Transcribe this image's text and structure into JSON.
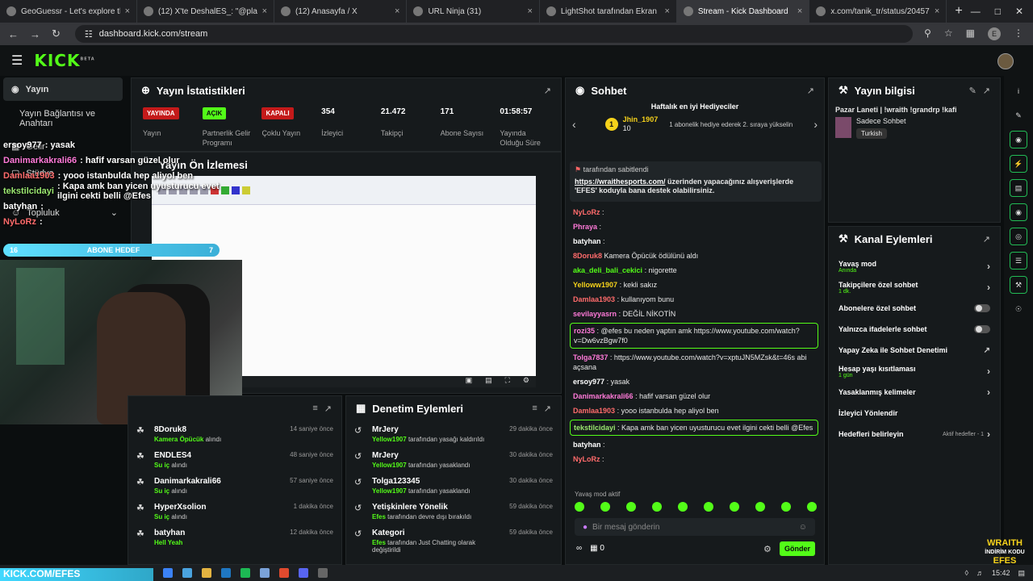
{
  "browser": {
    "tabs": [
      {
        "title": "GeoGuessr - Let's explore the w",
        "active": false
      },
      {
        "title": "(12) X'te DeshalES_: \"@platcom",
        "active": false
      },
      {
        "title": "(12) Anasayfa / X",
        "active": false
      },
      {
        "title": "URL Ninja (31)",
        "active": false
      },
      {
        "title": "LightShot tarafından Ekran Gör",
        "active": false
      },
      {
        "title": "Stream - Kick Dashboard",
        "active": true
      },
      {
        "title": "x.com/tanik_tr/status/2045768",
        "active": false
      }
    ],
    "url": "dashboard.kick.com/stream",
    "profile_letter": "E"
  },
  "kick": {
    "logo": "KICK",
    "logo_sup": "BETA"
  },
  "leftnav": {
    "items": [
      {
        "label": "Yayın",
        "active": true
      },
      {
        "label": "Yayın Bağlantısı ve Anahtarı"
      },
      {
        "label": "Gelir"
      },
      {
        "label": "Stüdyo"
      },
      {
        "label": "Topluluk"
      }
    ]
  },
  "stats_panel": {
    "title": "Yayın İstatistikleri",
    "items": [
      {
        "value": "YAYINDA",
        "label": "Yayın",
        "type": "red"
      },
      {
        "value": "AÇIK",
        "label": "Partnerlik Gelir Programı",
        "type": "green"
      },
      {
        "value": "KAPALI",
        "label": "Çoklu Yayın",
        "type": "red"
      },
      {
        "value": "354",
        "label": "İzleyici",
        "type": "text"
      },
      {
        "value": "21.472",
        "label": "Takipçi",
        "type": "text"
      },
      {
        "value": "171",
        "label": "Abone Sayısı",
        "type": "text"
      },
      {
        "value": "01:58:57",
        "label": "Yayında Olduğu Süre",
        "type": "text"
      }
    ]
  },
  "preview_title": "Yayın Ön İzlemesi",
  "overlay_chat": [
    {
      "user": "ersoy977",
      "text": ": yasak",
      "color": "#ffffff"
    },
    {
      "user": "Danimarkakrali66",
      "text": ": hafif varsan güzel olur",
      "color": "#ff7ad9"
    },
    {
      "user": "Damlaa1903",
      "text": ": yooo istanbulda hep aliyol ben",
      "color": "#ff6b6b"
    },
    {
      "user": "tekstilcidayi",
      "text": ": Kapa amk ban yicen uyusturucu evet ilgini cekti belli @Efes",
      "color": "#9be870"
    },
    {
      "user": "batyhan",
      "text": ":",
      "color": "#ffffff"
    },
    {
      "user": "NyLoRz",
      "text": ":",
      "color": "#ff6b6b"
    }
  ],
  "goal": {
    "left": "16",
    "label": "ABONE HEDEF",
    "right": "7"
  },
  "follows": [
    {
      "name": "8Doruk8",
      "by": "Kamera Öpücük",
      "action": "alındı",
      "time": "14 saniye önce"
    },
    {
      "name": "ENDLES4",
      "by": "Su iç",
      "action": "alındı",
      "time": "48 saniye önce"
    },
    {
      "name": "Danimarkakrali66",
      "by": "Su iç",
      "action": "alındı",
      "time": "57 saniye önce"
    },
    {
      "name": "HyperXsolion",
      "by": "Su iç",
      "action": "alındı",
      "time": "1 dakika önce"
    },
    {
      "name": "batyhan",
      "by": "Hell Yeah",
      "action": "",
      "time": "12 dakika önce"
    }
  ],
  "modactions": {
    "title": "Denetim Eylemleri",
    "items": [
      {
        "name": "MrJery",
        "by": "Yellow1907",
        "action": "tarafından yasağı kaldırıldı",
        "time": "29 dakika önce"
      },
      {
        "name": "MrJery",
        "by": "Yellow1907",
        "action": "tarafından yasaklandı",
        "time": "30 dakika önce"
      },
      {
        "name": "Tolga123345",
        "by": "Yellow1907",
        "action": "tarafından yasaklandı",
        "time": "30 dakika önce"
      },
      {
        "name": "Yetişkinlere Yönelik",
        "by": "Efes",
        "action": "tarafından devre dışı bırakıldı",
        "time": "59 dakika önce"
      },
      {
        "name": "Kategori",
        "by": "Efes",
        "action": "tarafından Just Chatting olarak değiştirildi",
        "time": "59 dakika önce"
      }
    ]
  },
  "chat": {
    "title": "Sohbet",
    "gifters_title": "Haftalık en iyi Hediyeciler",
    "top_gifter": "Jhin_1907",
    "top_gifter_count": "10",
    "gift_hint": "1 abonelik hediye ederek 2. sıraya yükselin",
    "pinned_by": "tarafından sabitlendi",
    "pinned_link": "https://wraithesports.com/",
    "pinned_text": "üzerinden yapacağınız alışverişlerde 'EFES' koduyla bana destek olabilirsiniz.",
    "messages": [
      {
        "user": "NyLoRz",
        "text": ":",
        "color": "#ff6b6b"
      },
      {
        "user": "Phraya",
        "text": ":",
        "color": "#ff7ad9"
      },
      {
        "user": "batyhan",
        "text": ":",
        "color": "#ffffff"
      },
      {
        "user": "8Doruk8",
        "text": "Kamera Öpücük ödülünü aldı",
        "color": "#ff6b6b"
      },
      {
        "user": "aka_deli_bali_cekici",
        "text": ": nigorette",
        "color": "#53fc18"
      },
      {
        "user": "Yelloww1907",
        "text": ": kekli sakız",
        "color": "#f6d21b"
      },
      {
        "user": "Damlaa1903",
        "text": ": kullanıyom bunu",
        "color": "#ff6b6b"
      },
      {
        "user": "sevilayyasrn",
        "text": ": DEĞİL NİKOTİN",
        "color": "#ff7ad9"
      },
      {
        "user": "rozi35",
        "text": ": @efes bu neden yaptın amk https://www.youtube.com/watch?v=Dw6vzBgw7f0",
        "color": "#ff7ad9",
        "hl": true
      },
      {
        "user": "Tolga7837",
        "text": ": https://www.youtube.com/watch?v=xptuJN5MZsk&t=46s abi açsana",
        "color": "#ff7ad9"
      },
      {
        "user": "ersoy977",
        "text": ": yasak",
        "color": "#ffffff"
      },
      {
        "user": "Danimarkakrali66",
        "text": ": hafif varsan güzel olur",
        "color": "#ff7ad9"
      },
      {
        "user": "Damlaa1903",
        "text": ": yooo istanbulda hep aliyol ben",
        "color": "#ff6b6b"
      },
      {
        "user": "tekstilcidayi",
        "text": ": Kapa amk ban yicen uyusturucu evet ilgini cekti belli @Efes",
        "color": "#9be870",
        "hl": true
      },
      {
        "user": "batyhan",
        "text": ":",
        "color": "#ffffff"
      },
      {
        "user": "NyLoRz",
        "text": ":",
        "color": "#ff6b6b"
      }
    ],
    "slow_mode": "Yavaş mod aktif",
    "input_placeholder": "Bir mesaj gönderin",
    "send_label": "Gönder",
    "points": "0"
  },
  "stream_info": {
    "title": "Yayın bilgisi",
    "stream_title": "Pazar Laneti | !wraith !grandrp !kafi",
    "category": "Sadece Sohbet",
    "language": "Turkish"
  },
  "channel_actions": {
    "title": "Kanal Eylemleri",
    "rows": [
      {
        "label": "Yavaş mod",
        "sub": "Anında",
        "ctrl": "chev"
      },
      {
        "label": "Takipçilere özel sohbet",
        "sub": "1 dk.",
        "ctrl": "chev"
      },
      {
        "label": "Abonelere özel sohbet",
        "sub": "",
        "ctrl": "toggle"
      },
      {
        "label": "Yalnızca ifadelerle sohbet",
        "sub": "",
        "ctrl": "toggle"
      },
      {
        "label": "Yapay Zeka ile Sohbet Denetimi",
        "sub": "",
        "ctrl": "ext"
      },
      {
        "label": "Hesap yaşı kısıtlaması",
        "sub": "1 gün",
        "ctrl": "chev"
      },
      {
        "label": "Yasaklanmış kelimeler",
        "sub": "",
        "ctrl": "chev"
      },
      {
        "label": "İzleyici Yönlendir",
        "sub": "",
        "ctrl": "none"
      },
      {
        "label": "Hedefleri belirleyin",
        "sub": "",
        "ctrl": "chev",
        "note": "Aktif hedefler - 1"
      }
    ]
  },
  "banner": "KICK.COM/EFES",
  "wraith": {
    "name": "WRAITH",
    "line2": "İNDİRİM KODU",
    "code": "EFES"
  },
  "clock": "15:42"
}
